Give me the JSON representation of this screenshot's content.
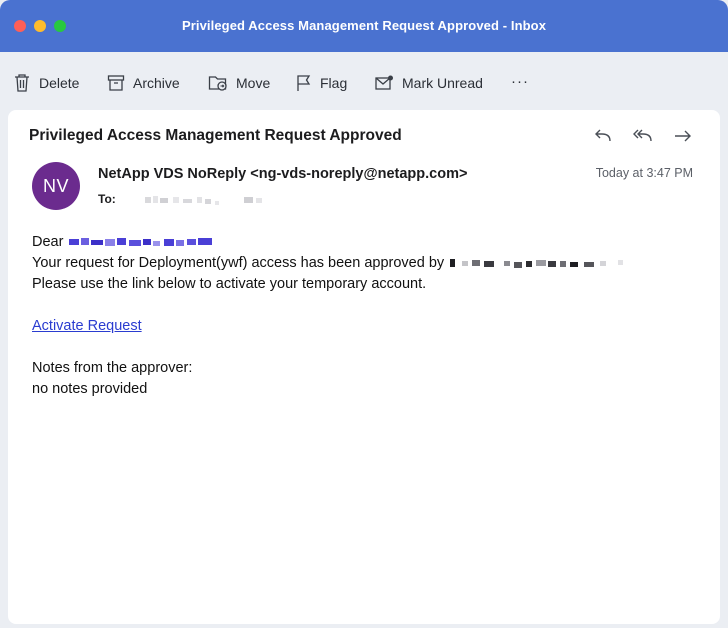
{
  "window": {
    "title": "Privileged Access Management Request Approved - Inbox"
  },
  "toolbar": {
    "delete_label": "Delete",
    "archive_label": "Archive",
    "move_label": "Move",
    "flag_label": "Flag",
    "mark_unread_label": "Mark Unread",
    "more_label": "···"
  },
  "message": {
    "subject": "Privileged Access Management Request Approved",
    "avatar_initials": "NV",
    "avatar_color": "#6b2b8e",
    "from": "NetApp VDS NoReply <ng-vds-noreply@netapp.com>",
    "to_label": "To:",
    "timestamp": "Today at 3:47 PM",
    "body": {
      "greeting": "Dear",
      "line1": "Your request for Deployment(ywf) access has been approved by",
      "line2": "Please use the link below to activate your temporary account.",
      "link_text": "Activate Request",
      "notes_label": "Notes from the approver:",
      "notes_value": "no notes provided"
    }
  },
  "colors": {
    "titlebar": "#4a72d0",
    "link": "#2a3cd0"
  }
}
